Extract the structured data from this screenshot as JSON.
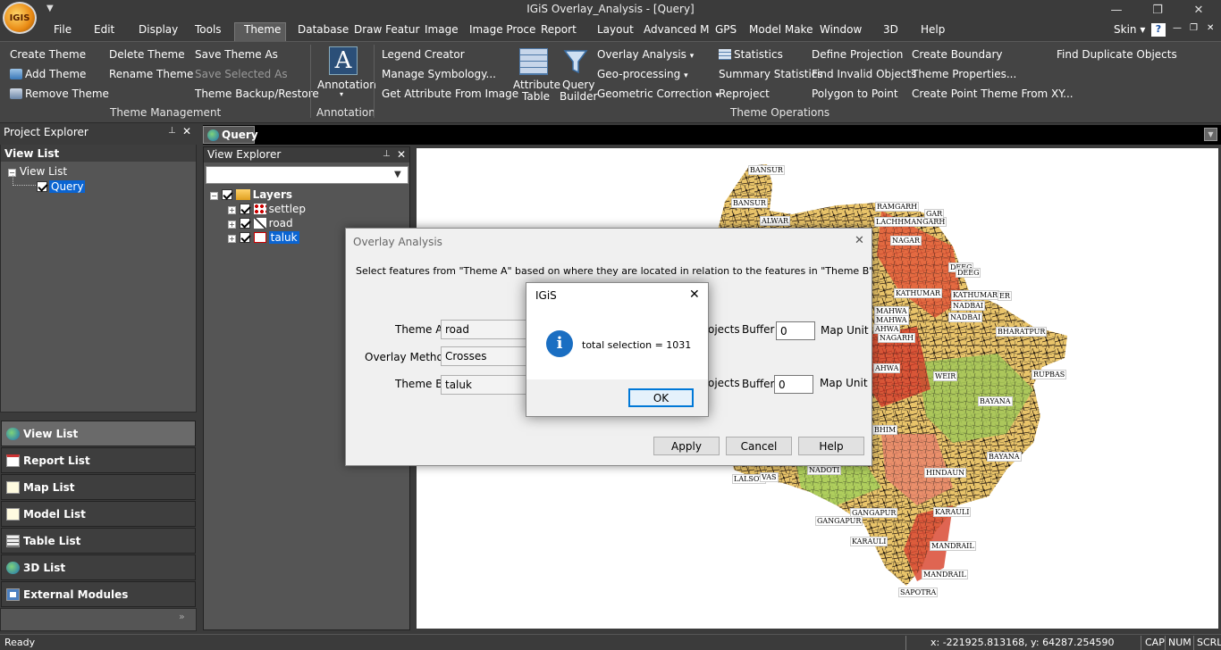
{
  "app": {
    "logo_text": "IGIS",
    "title": "IGiS Overlay_Analysis - [Query]",
    "quick_access_icon": "chevron-down-icon"
  },
  "window_controls": {
    "minimize": "—",
    "restore": "❐",
    "close": "✕"
  },
  "menubar": {
    "items": [
      "File",
      "Edit",
      "Display",
      "Tools",
      "Theme",
      "Database",
      "Draw Featur",
      "Image",
      "Image Proce",
      "Report",
      "Layout",
      "Advanced M",
      "GPS",
      "Model Make",
      "Window",
      "3D",
      "Help"
    ],
    "active": "Theme",
    "skin_label": "Skin",
    "help_icon": "?",
    "mdi_controls": [
      "—",
      "❐",
      "✕"
    ]
  },
  "ribbon": {
    "theme_management": {
      "create_theme": "Create Theme",
      "add_theme": "Add Theme",
      "remove_theme": "Remove Theme",
      "delete_theme": "Delete Theme",
      "rename_theme": "Rename Theme",
      "save_theme_as": "Save Theme As",
      "save_selected_as": "Save Selected As",
      "theme_backup": "Theme Backup/Restore",
      "group_label": "Theme Management"
    },
    "annotation": {
      "button_label": "Annotation",
      "group_label": "Annotation",
      "icon_letter": "A"
    },
    "theme_operations": {
      "legend_creator": "Legend Creator",
      "manage_symbology": "Manage Symbology...",
      "get_attribute": "Get Attribute From Image",
      "attribute_table_1": "Attribute",
      "attribute_table_2": "Table",
      "query_builder_1": "Query",
      "query_builder_2": "Builder",
      "overlay_analysis": "Overlay Analysis",
      "geo_processing": "Geo-processing",
      "geometric_correction": "Geometric Correction",
      "statistics": "Statistics",
      "summary_statistics": "Summary Statistics",
      "reproject": "Reproject",
      "define_projection": "Define Projection",
      "find_invalid": "Find Invalid Objects",
      "polygon_to_point": "Polygon to Point",
      "create_boundary": "Create Boundary",
      "theme_properties": "Theme Properties...",
      "create_point_theme": "Create Point Theme From XY...",
      "find_duplicate": "Find Duplicate Objects",
      "group_label": "Theme Operations"
    }
  },
  "project_explorer": {
    "title": "Project Explorer",
    "pin": "📌",
    "close": "✕",
    "view_list_header": "View List",
    "tree_root": "View List",
    "tree_child": "Query"
  },
  "nav_buttons": [
    "View List",
    "Report List",
    "Map List",
    "Model List",
    "Table List",
    "3D List",
    "External Modules"
  ],
  "nav_grip": "»",
  "document_tab": "Query",
  "view_explorer": {
    "title": "View Explorer",
    "pin": "📌",
    "close": "✕",
    "combo_value": "",
    "layers_label": "Layers",
    "layers": [
      "settlep",
      "road",
      "taluk"
    ],
    "selected_layer": "taluk"
  },
  "map_labels": [
    "BANSUR",
    "BANSUR",
    "ALWAR",
    "RAMGARH",
    "LACHHMANGARH",
    "NAGAR",
    "DEEG",
    "DEEG",
    "KATHUMAR",
    "KATHUMAR",
    "NADBAI",
    "NADBAI",
    "BHARATPUR",
    "MAHWA",
    "MAHWA",
    "NAGARH",
    "WEIR",
    "RUPBAS",
    "BAYANA",
    "BAYANA",
    "HINDAUN",
    "NADOTI",
    "LALSOT",
    "GANGAPUR",
    "GANGAPUR",
    "KARAULI",
    "KARAULI",
    "MANDRAIL",
    "MANDRAIL",
    "SAPOTRA",
    "BHIM",
    "VAS",
    "AHWA",
    "GAR",
    "ER",
    "AHWA"
  ],
  "overlay_dialog": {
    "title": "Overlay Analysis",
    "close": "✕",
    "instruction": "Select features from \"Theme A\" based on where they are located in relation to the features in \"Theme B\"",
    "theme_a_label": "Theme A :",
    "theme_a_value": "road",
    "overlay_method_label": "Overlay Method :",
    "overlay_method_value": "Crosses",
    "theme_b_label": "Theme B :",
    "theme_b_value": "taluk",
    "objects_partial_1": "ojects",
    "objects_partial_2": "ojects",
    "buffer_label_1": "Buffer :",
    "buffer_value_1": "0",
    "buffer_unit_1": "Map Unit",
    "buffer_label_2": "Buffer :",
    "buffer_value_2": "0",
    "buffer_unit_2": "Map Unit",
    "apply": "Apply",
    "cancel": "Cancel",
    "help": "Help"
  },
  "message_box": {
    "title": "IGiS",
    "close": "✕",
    "icon": "i",
    "message": "total selection = 1031",
    "ok": "OK"
  },
  "status": {
    "ready": "Ready",
    "coords": "x: -221925.813168,   y: 64287.254590",
    "cap": "CAP",
    "num": "NUM",
    "scrl": "SCRL"
  }
}
